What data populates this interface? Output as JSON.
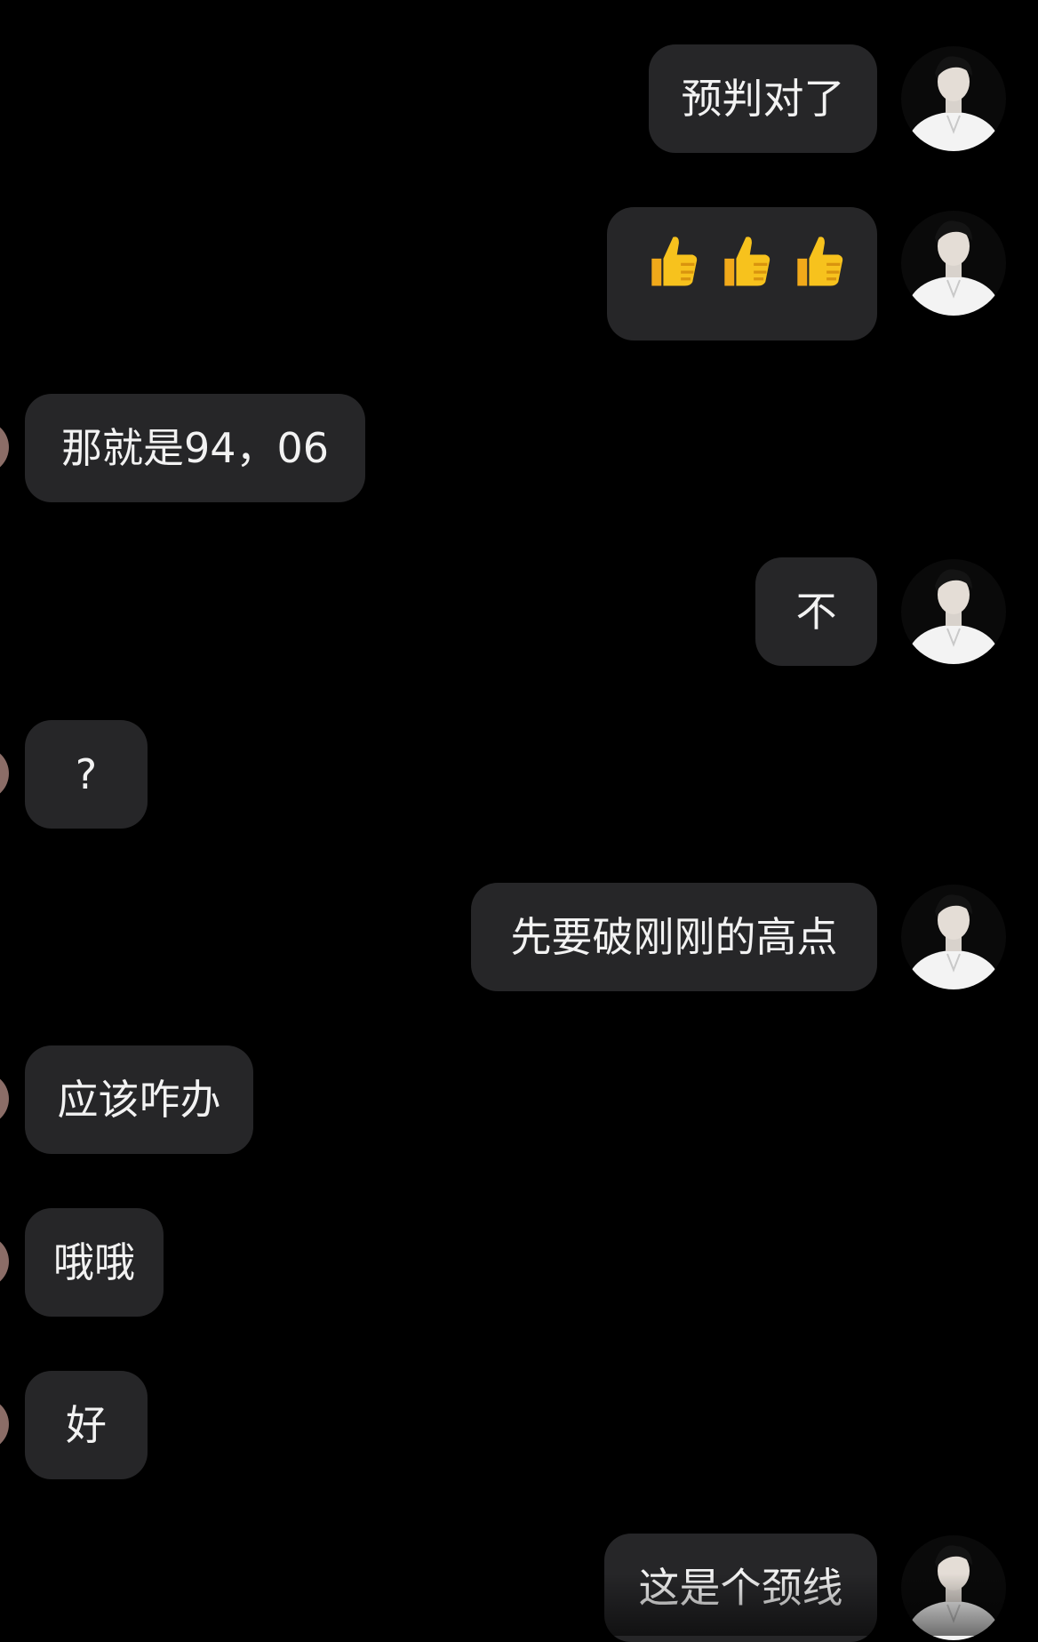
{
  "messages": [
    {
      "side": "right",
      "text": "预判对了"
    },
    {
      "side": "right",
      "emoji": [
        "thumbs-up",
        "thumbs-up",
        "thumbs-up"
      ]
    },
    {
      "side": "left",
      "text": "那就是94，06"
    },
    {
      "side": "right",
      "text": "不"
    },
    {
      "side": "left",
      "text": "?"
    },
    {
      "side": "right",
      "text": "先要破刚刚的高点"
    },
    {
      "side": "left",
      "text": "应该咋办"
    },
    {
      "side": "left",
      "text": "哦哦"
    },
    {
      "side": "left",
      "text": "好"
    },
    {
      "side": "right",
      "text": "这是个颈线"
    }
  ],
  "colors": {
    "background": "#000000",
    "bubble": "#262628",
    "text": "#f2f2f2",
    "emoji_yellow": "#f7c21d"
  },
  "icons": {
    "thumbs_up": "thumbs-up-icon",
    "avatar_right": "user-avatar-photo",
    "avatar_left": "contact-avatar-partial"
  }
}
